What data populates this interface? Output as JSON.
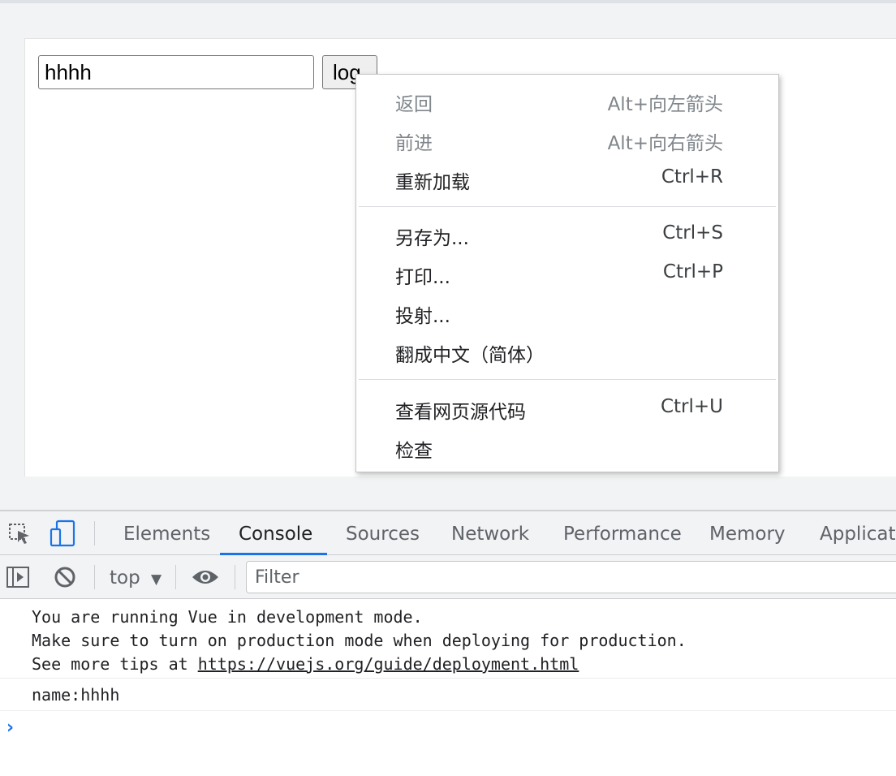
{
  "page": {
    "input_value": "hhhh",
    "button_label": "log"
  },
  "context_menu": {
    "items": [
      {
        "label": "返回",
        "shortcut": "Alt+向左箭头",
        "disabled": true
      },
      {
        "label": "前进",
        "shortcut": "Alt+向右箭头",
        "disabled": true
      },
      {
        "label": "重新加载",
        "shortcut": "Ctrl+R",
        "disabled": false
      },
      {
        "label": "另存为...",
        "shortcut": "Ctrl+S",
        "disabled": false
      },
      {
        "label": "打印...",
        "shortcut": "Ctrl+P",
        "disabled": false
      },
      {
        "label": "投射...",
        "shortcut": "",
        "disabled": false
      },
      {
        "label": "翻成中文（简体）",
        "shortcut": "",
        "disabled": false
      },
      {
        "label": "查看网页源代码",
        "shortcut": "Ctrl+U",
        "disabled": false
      },
      {
        "label": "检查",
        "shortcut": "",
        "disabled": false
      }
    ]
  },
  "devtools": {
    "tabs": [
      "Elements",
      "Console",
      "Sources",
      "Network",
      "Performance",
      "Memory",
      "Applicati"
    ],
    "active_tab": "Console",
    "accent_color": "#1a73e8",
    "context": "top",
    "filter_placeholder": "Filter",
    "console": {
      "vue_lines": [
        "You are running Vue in development mode.",
        "Make sure to turn on production mode when deploying for production.",
        "See more tips at "
      ],
      "vue_link": "https://vuejs.org/guide/deployment.html",
      "log_message": "name:hhhh",
      "prompt": "›"
    }
  }
}
